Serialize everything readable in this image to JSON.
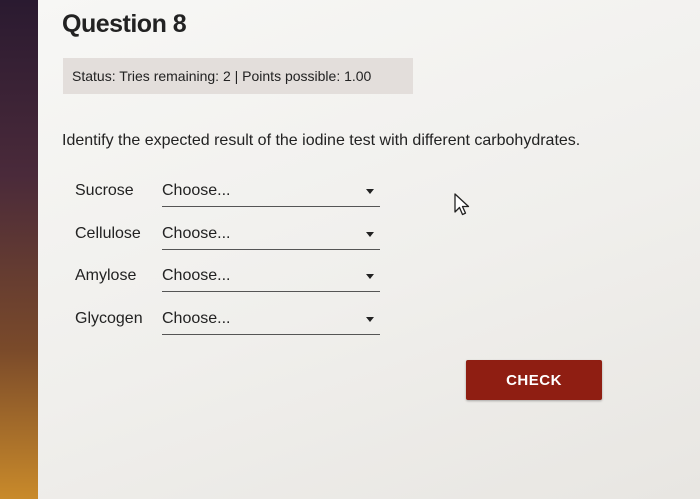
{
  "question": {
    "title": "Question 8",
    "status": "Status: Tries remaining: 2 | Points possible: 1.00",
    "prompt": "Identify the expected result of the iodine test with different carbohydrates."
  },
  "rows": [
    {
      "label": "Sucrose",
      "value": "Choose..."
    },
    {
      "label": "Cellulose",
      "value": "Choose..."
    },
    {
      "label": "Amylose",
      "value": "Choose..."
    },
    {
      "label": "Glycogen",
      "value": "Choose..."
    }
  ],
  "actions": {
    "check_label": "CHECK"
  },
  "colors": {
    "check_button": "#8f1e12",
    "status_background": "#e3dedb"
  },
  "icons": {
    "cursor": "mouse-pointer-icon",
    "dropdown": "caret-down-icon"
  }
}
